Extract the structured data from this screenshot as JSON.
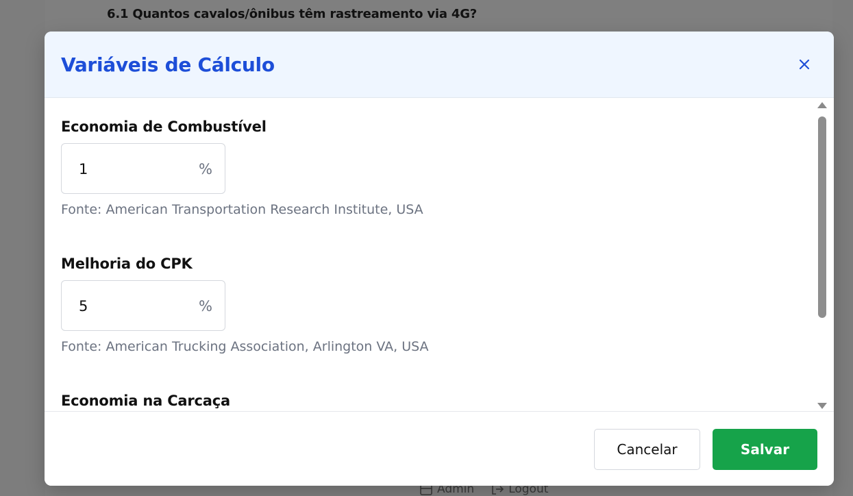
{
  "background": {
    "question": "6.1 Quantos cavalos/ônibus têm rastreamento via 4G?",
    "footer": {
      "admin_label": "Admin",
      "logout_label": "Logout"
    }
  },
  "modal": {
    "title": "Variáveis de Cálculo",
    "close_icon": "close-icon",
    "fields": [
      {
        "label": "Economia de Combustível",
        "value": "1",
        "unit": "%",
        "source": "Fonte: American Transportation Research Institute, USA"
      },
      {
        "label": "Melhoria do CPK",
        "value": "5",
        "unit": "%",
        "source": "Fonte: American Trucking Association, Arlington VA, USA"
      },
      {
        "label": "Economia na Carcaça"
      }
    ],
    "buttons": {
      "cancel": "Cancelar",
      "save": "Salvar"
    }
  },
  "colors": {
    "title": "#1d4ed8",
    "header_bg": "#eff6ff",
    "save_button": "#16a34a"
  }
}
